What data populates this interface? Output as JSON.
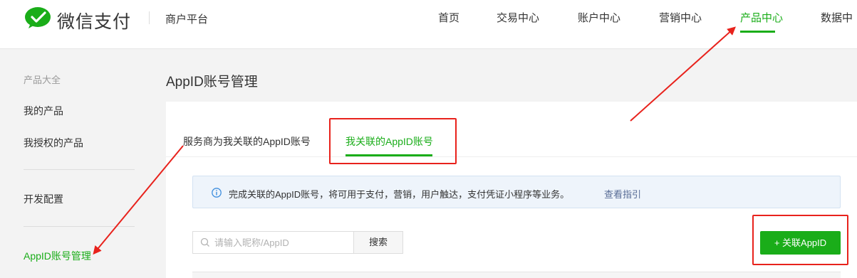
{
  "header": {
    "brand": "微信支付",
    "platform": "商户平台",
    "nav": [
      {
        "label": "首页"
      },
      {
        "label": "交易中心"
      },
      {
        "label": "账户中心"
      },
      {
        "label": "营销中心"
      },
      {
        "label": "产品中心",
        "active": true
      },
      {
        "label": "数据中"
      }
    ]
  },
  "sidebar": {
    "heading": "产品大全",
    "items": [
      {
        "label": "我的产品"
      },
      {
        "label": "我授权的产品"
      },
      {
        "label": "开发配置"
      },
      {
        "label": "AppID账号管理",
        "active": true
      }
    ]
  },
  "main": {
    "title": "AppID账号管理",
    "tabs": [
      {
        "label": "服务商为我关联的AppID账号"
      },
      {
        "label": "我关联的AppID账号",
        "active": true
      }
    ],
    "notice": {
      "text": "完成关联的AppID账号，将可用于支付，营销，用户触达，支付凭证小程序等业务。",
      "link": "查看指引"
    },
    "search": {
      "placeholder": "请输入昵称/AppID",
      "value": "",
      "button": "搜索"
    },
    "add_button": "+ 关联AppID"
  },
  "colors": {
    "accent": "#1aad19",
    "link": "#576b95",
    "annotation": "#e8221c",
    "notice_bg": "#eef4fb"
  },
  "icons": [
    "wechat-pay-logo",
    "info-icon",
    "search-icon"
  ]
}
